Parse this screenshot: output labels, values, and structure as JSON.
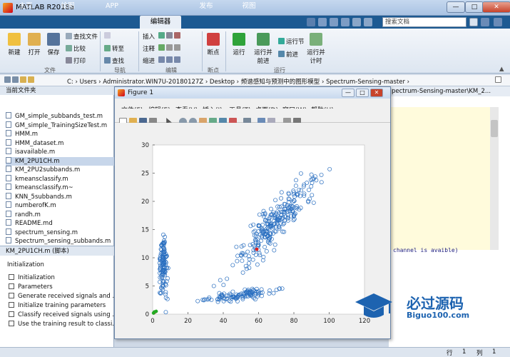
{
  "window": {
    "title": "MATLAB R2018a",
    "minimize": "—",
    "maximize": "□",
    "close": "✕"
  },
  "tabs": [
    "主页",
    "绘图",
    "APP",
    "编辑器",
    "发布",
    "视图"
  ],
  "search": {
    "placeholder": "搜索文档"
  },
  "ribbon": {
    "new": "新建",
    "open": "打开",
    "save": "保存",
    "find_files": "查找文件",
    "compare": "比较",
    "print": "打印",
    "goto": "转至",
    "find": "查找",
    "insert": "插入",
    "comment": "注释",
    "indent": "缩进",
    "breakpoints": "断点",
    "run": "运行",
    "run_advance": "运行并\n前进",
    "run_section": "运行节",
    "advance": "前进",
    "run_time": "运行并\n计时",
    "groups": {
      "file": "文件",
      "navigate": "导航",
      "edit": "编辑",
      "breakpoints": "断点",
      "run": "运行"
    }
  },
  "address": {
    "segments": "C: › Users › Administrator.WIN7U-20180127Z › Desktop › 频谱感知与预测中的图形模型 › Spectrum-Sensing-master ›"
  },
  "current_folder": {
    "title": "当前文件夹",
    "files": [
      "GM_simple_subbands_test.m",
      "GM_simple_TrainingSizeTest.m",
      "HMM.m",
      "HMM_dataset.m",
      "isavailable.m",
      "KM_2PU1CH.m",
      "KM_2PU2subbands.m",
      "kmeansclassify.m",
      "kmeansclassify.m~",
      "KNN_5subbands.m",
      "numberofK.m",
      "randh.m",
      "README.md",
      "spectrum_sensing.m",
      "Spectrum_sensing_subbands.m"
    ],
    "selected": "KM_2PU1CH.m"
  },
  "details": {
    "header": "KM_2PU1CH.m  (脚本)",
    "title": "Initialization",
    "items": [
      "Initialization",
      "Parameters",
      "Generate received signals and ...",
      "Initialize training parameters",
      "Classify received signals using ...",
      "Use the training result to classi..."
    ]
  },
  "editor": {
    "tab": "pectrum-Sensing-master\\KM_2...",
    "code_line": "channel is avaible)"
  },
  "status": {
    "row_label": "行",
    "row": "1",
    "col_label": "列",
    "col": "1"
  },
  "figure": {
    "title": "Figure 1",
    "menu": [
      "文件(F)",
      "编辑(E)",
      "查看(V)",
      "插入(I)",
      "工具(T)",
      "桌面(D)",
      "窗口(W)",
      "帮助(H)"
    ]
  },
  "watermark": {
    "main": "必过源码",
    "sub": "Biguo100.com"
  },
  "chart_data": {
    "type": "scatter",
    "xlim": [
      0,
      120
    ],
    "ylim": [
      0,
      30
    ],
    "xticks": [
      0,
      20,
      40,
      60,
      80,
      100,
      120
    ],
    "yticks": [
      0,
      5,
      10,
      15,
      20,
      25,
      30
    ],
    "grid": false,
    "series": [
      {
        "marker": "open-circle",
        "color": "#2a6fc0",
        "clusters": [
          {
            "label": "vertical",
            "x_center": 6,
            "x_spread": 1.5,
            "y_center": 8.5,
            "y_spread": 3.2,
            "count": 120
          },
          {
            "label": "horizontal",
            "x_center": 50,
            "x_spread": 14,
            "y_center": 3.7,
            "y_spread": 0.8,
            "count": 110
          },
          {
            "label": "diagonal",
            "x_center": 68,
            "x_spread": 16,
            "y_center": 17.5,
            "y_spread": 4.2,
            "count": 260
          }
        ]
      },
      {
        "marker": "filled-dot",
        "color": "#e02020",
        "points": [
          [
            59,
            11.5
          ],
          [
            1,
            0.3
          ]
        ]
      },
      {
        "marker": "filled-dot",
        "color": "#22aa22",
        "points": [
          [
            1,
            0.4
          ],
          [
            2,
            0.5
          ],
          [
            0.5,
            0.2
          ]
        ]
      }
    ]
  }
}
